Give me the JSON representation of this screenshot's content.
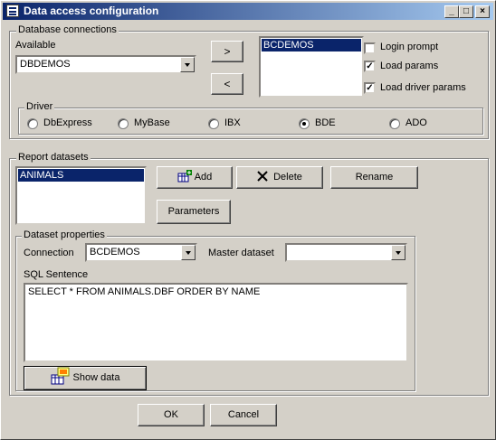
{
  "window": {
    "title": "Data access configuration",
    "controls": [
      "_",
      "□",
      "×"
    ]
  },
  "database_connections": {
    "legend": "Database connections",
    "available_label": "Available",
    "available_value": "DBDEMOS",
    "add_arrow": ">",
    "remove_arrow": "<",
    "selected_list": [
      "BCDEMOS"
    ],
    "options": [
      {
        "label": "Login prompt",
        "checked": false
      },
      {
        "label": "Load params",
        "checked": true
      },
      {
        "label": "Load driver params",
        "checked": true
      }
    ],
    "driver": {
      "legend": "Driver",
      "options": [
        "DbExpress",
        "MyBase",
        "IBX",
        "BDE",
        "ADO"
      ],
      "selected": "BDE"
    }
  },
  "report_datasets": {
    "legend": "Report datasets",
    "list": [
      "ANIMALS"
    ],
    "add_label": "Add",
    "delete_label": "Delete",
    "rename_label": "Rename",
    "parameters_label": "Parameters",
    "properties": {
      "legend": "Dataset properties",
      "connection_label": "Connection",
      "connection_value": "BCDEMOS",
      "master_label": "Master dataset",
      "master_value": "",
      "sql_label": "SQL Sentence",
      "sql_text": "SELECT * FROM ANIMALS.DBF ORDER BY NAME",
      "show_data_label": "Show data"
    }
  },
  "footer": {
    "ok_label": "OK",
    "cancel_label": "Cancel"
  },
  "icons": [
    "window-app-icon",
    "add-icon",
    "delete-icon",
    "show-data-icon"
  ]
}
